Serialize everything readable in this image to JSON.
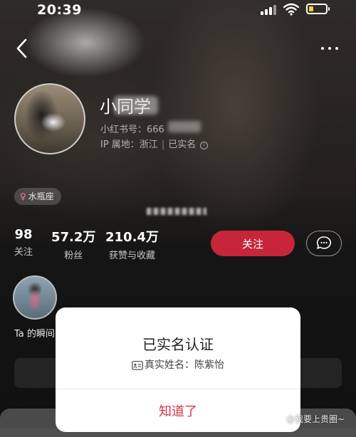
{
  "status_bar": {
    "time": "20:39"
  },
  "profile": {
    "nickname": "小同学",
    "red_id": "小红书号：666",
    "ip_location": "IP 属地：浙江",
    "verified_text": "已实名",
    "tag": "水瓶座"
  },
  "stats": [
    {
      "value": "98",
      "label": "关注"
    },
    {
      "value": "57.2万",
      "label": "粉丝"
    },
    {
      "value": "210.4万",
      "label": "获赞与收藏"
    }
  ],
  "actions": {
    "follow_label": "关注"
  },
  "moments": {
    "label": "Ta 的瞬间"
  },
  "modal": {
    "title": "已实名认证",
    "name_line": "真实姓名：陈紫怡",
    "ok_label": "知道了"
  },
  "watermark": "@我要上贵圈~",
  "colors": {
    "accent": "#c7263a",
    "modal_ok": "#d6324a"
  }
}
